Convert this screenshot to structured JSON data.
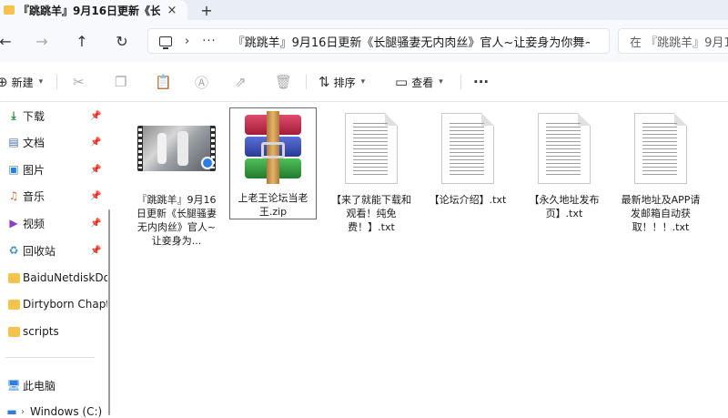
{
  "tab": {
    "title": "『跳跳羊』9月16日更新《长腿",
    "close": "×",
    "new": "+"
  },
  "nav": {
    "back": "←",
    "forward": "→",
    "up": "↑",
    "refresh": "↻",
    "chevron": "›",
    "more": "···",
    "path": "『跳跳羊』9月16日更新《长腿骚妻无内肉丝》官人~让妾身为你舞~",
    "search_placeholder": "在 『跳跳羊』9月1"
  },
  "toolbar": {
    "new_label": "新建",
    "sort_label": "排序",
    "view_label": "查看",
    "more": "···"
  },
  "sidebar": {
    "items": [
      {
        "label": "下载",
        "icon": "download-icon",
        "pinned": true
      },
      {
        "label": "文档",
        "icon": "document-icon",
        "pinned": true
      },
      {
        "label": "图片",
        "icon": "pictures-icon",
        "pinned": true
      },
      {
        "label": "音乐",
        "icon": "music-icon",
        "pinned": true
      },
      {
        "label": "视频",
        "icon": "video-icon",
        "pinned": true
      },
      {
        "label": "回收站",
        "icon": "recycle-bin-icon",
        "pinned": true
      },
      {
        "label": "BaiduNetdiskDo",
        "icon": "folder-icon",
        "pinned": false
      },
      {
        "label": "Dirtyborn Chapt",
        "icon": "folder-icon",
        "pinned": false
      },
      {
        "label": "scripts",
        "icon": "folder-icon",
        "pinned": false
      },
      {
        "label": "此电脑",
        "icon": "this-pc-icon",
        "pinned": false
      },
      {
        "label": "Windows (C:)",
        "icon": "drive-icon",
        "pinned": false
      }
    ]
  },
  "files": [
    {
      "name": "『跳跳羊』9月16日更新《长腿骚妻无内肉丝》官人~让妾身为...",
      "type": "video"
    },
    {
      "name": "上老王论坛当老王.zip",
      "type": "archive",
      "selected": true
    },
    {
      "name": "【来了就能下载和观看！纯免费！】.txt",
      "type": "text"
    },
    {
      "name": "【论坛介绍】.txt",
      "type": "text"
    },
    {
      "name": "【永久地址发布页】.txt",
      "type": "text"
    },
    {
      "name": "最新地址及APP请发邮箱自动获取！！！.txt",
      "type": "text"
    }
  ]
}
